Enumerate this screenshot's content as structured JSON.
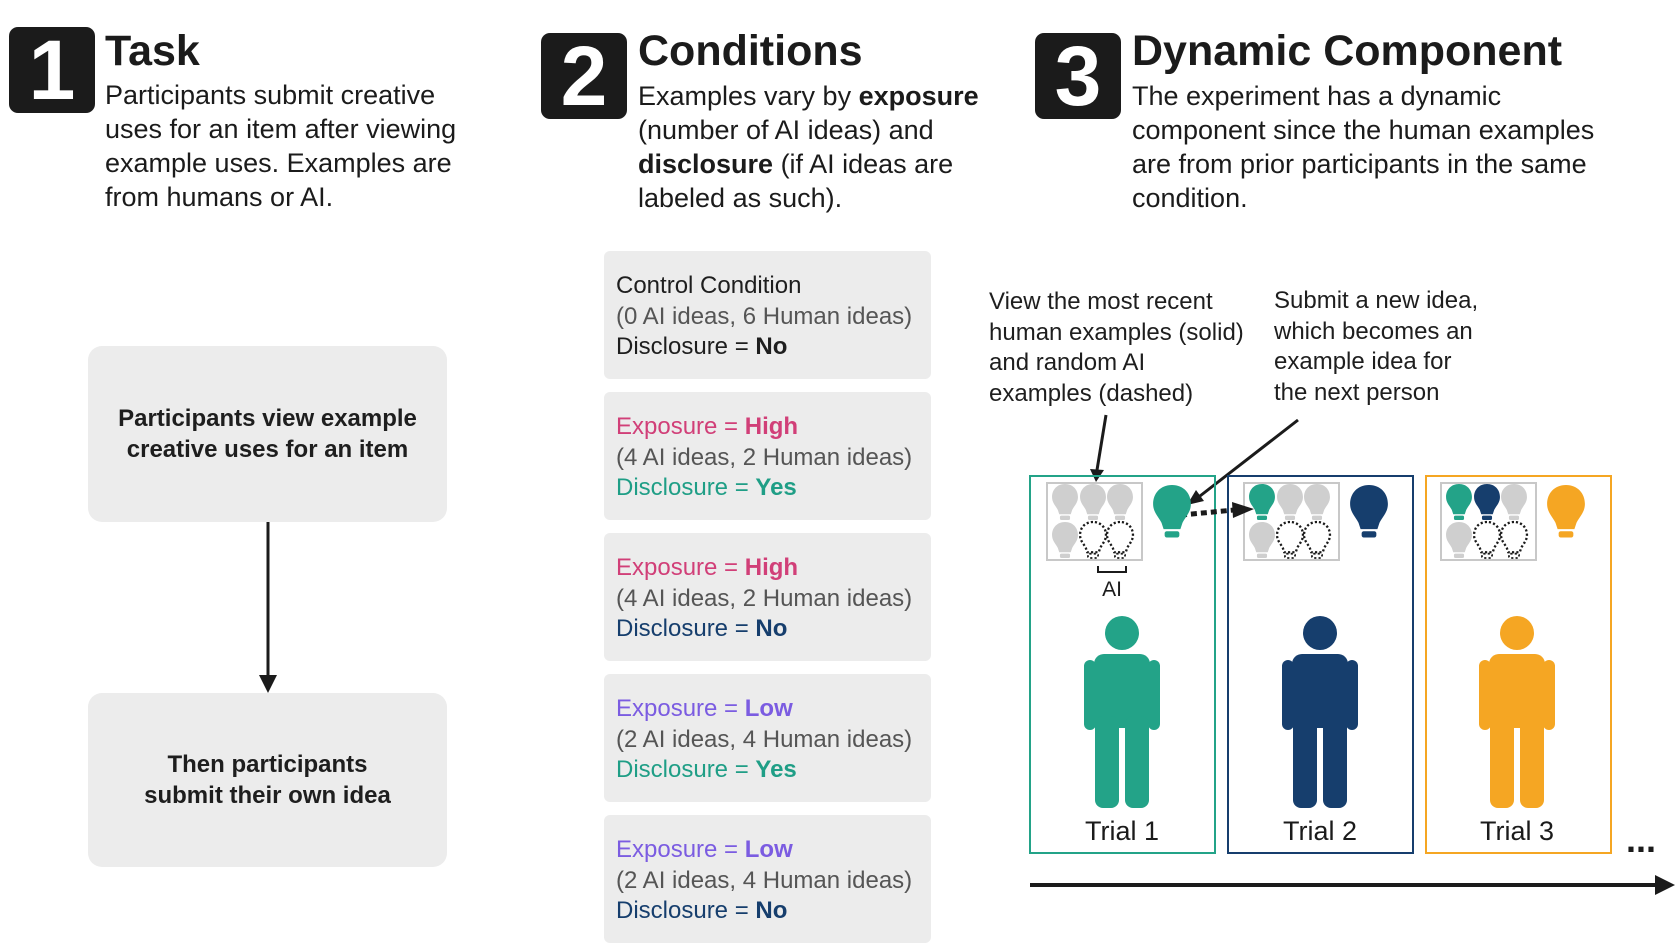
{
  "sections": [
    {
      "number": "1",
      "title": "Task",
      "description": "Participants submit creative uses for an item after viewing example uses. Examples are from humans or AI."
    },
    {
      "number": "2",
      "title": "Conditions",
      "description_parts": [
        "Examples vary by ",
        "exposure",
        " (number of AI ideas) and ",
        "disclosure",
        " (if AI ideas are labeled as such)."
      ]
    },
    {
      "number": "3",
      "title": "Dynamic Component",
      "description": "The experiment has a dynamic component since the human examples are from prior participants in the same condition."
    }
  ],
  "flow": {
    "step1": "Participants view example creative uses for an item",
    "step2": "Then participants submit their own idea"
  },
  "conditions": [
    {
      "line1_label": "Control Condition",
      "line1_value": "",
      "line2": "(0 AI ideas,  6 Human ideas)",
      "line3_label": "Disclosure = ",
      "line3_value": "No"
    },
    {
      "line1_label": "Exposure = ",
      "line1_value": "High",
      "line2": "(4 AI ideas,  2 Human ideas)",
      "line3_label": "Disclosure = ",
      "line3_value": "Yes"
    },
    {
      "line1_label": "Exposure = ",
      "line1_value": "High",
      "line2": "(4 AI ideas,  2 Human ideas)",
      "line3_label": "Disclosure = ",
      "line3_value": "No"
    },
    {
      "line1_label": "Exposure = ",
      "line1_value": "Low",
      "line2": "(2 AI ideas,  4 Human ideas)",
      "line3_label": "Disclosure = ",
      "line3_value": "Yes"
    },
    {
      "line1_label": "Exposure = ",
      "line1_value": "Low",
      "line2": "(2 AI ideas,  4 Human ideas)",
      "line3_label": "Disclosure = ",
      "line3_value": "No"
    }
  ],
  "annotations": {
    "view": [
      "View the most recent",
      "human examples (solid)",
      "and random AI",
      "examples (dashed)"
    ],
    "submit": [
      "Submit a new idea,",
      "which becomes an",
      "example idea for",
      "the next person"
    ],
    "ai_label": "AI"
  },
  "trials": [
    {
      "label": "Trial 1",
      "color": "#23a388"
    },
    {
      "label": "Trial 2",
      "color": "#163e6d"
    },
    {
      "label": "Trial 3",
      "color": "#f5a623"
    }
  ],
  "ellipsis": "...",
  "colors": {
    "exposure_high": "#d13f78",
    "exposure_low": "#7b5ce1",
    "disclosure_yes": "#1f9e86",
    "disclosure_no": "#163e6d",
    "example_gray": "#cfcfcf",
    "box_gray": "#ececec"
  }
}
